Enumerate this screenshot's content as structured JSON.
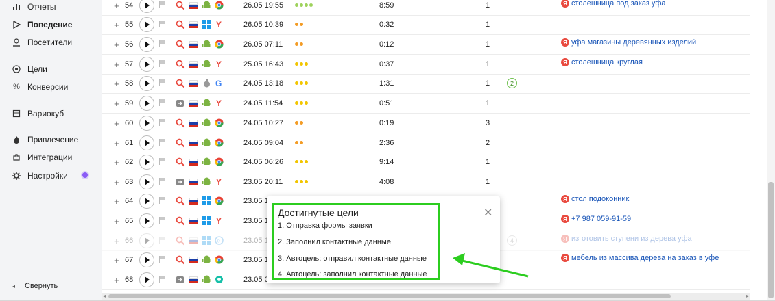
{
  "sidebar": {
    "items": [
      {
        "label": "Отчеты",
        "icon": "bar-chart-icon",
        "active": false
      },
      {
        "label": "Поведение",
        "icon": "play-outline-icon",
        "active": true
      },
      {
        "label": "Посетители",
        "icon": "user-icon",
        "active": false
      },
      {
        "label": "Цели",
        "icon": "target-icon",
        "active": false
      },
      {
        "label": "Конверсии",
        "icon": "percent-icon",
        "active": false
      },
      {
        "label": "Вариокуб",
        "icon": "cube-icon",
        "active": false
      },
      {
        "label": "Привлечение",
        "icon": "flame-icon",
        "active": false
      },
      {
        "label": "Интеграции",
        "icon": "puzzle-icon",
        "active": false
      },
      {
        "label": "Настройки",
        "icon": "gear-icon",
        "active": false
      }
    ],
    "collapse_label": "Свернуть"
  },
  "rows": [
    {
      "num": "54",
      "date": "26.05 19:55",
      "depth_dots": 4,
      "depth_color": "#9ed25c",
      "time": "8:59",
      "views": "1",
      "goals": "",
      "search": "столешница под заказ уфа",
      "os": "android",
      "browser": "chrome",
      "source": "search",
      "faded": false
    },
    {
      "num": "55",
      "date": "26.05 10:39",
      "depth_dots": 2,
      "depth_color": "#f39c25",
      "time": "0:32",
      "views": "1",
      "goals": "",
      "search": "",
      "os": "windows",
      "browser": "yandex",
      "source": "search",
      "faded": false
    },
    {
      "num": "56",
      "date": "26.05 07:11",
      "depth_dots": 2,
      "depth_color": "#f39c25",
      "time": "0:12",
      "views": "1",
      "goals": "",
      "search": "уфа магазины деревянных изделий",
      "os": "android",
      "browser": "chrome",
      "source": "search",
      "faded": false
    },
    {
      "num": "57",
      "date": "25.05 16:43",
      "depth_dots": 3,
      "depth_color": "#f2c500",
      "time": "0:37",
      "views": "1",
      "goals": "",
      "search": "столешница круглая",
      "os": "android",
      "browser": "yandex",
      "source": "search",
      "faded": false
    },
    {
      "num": "58",
      "date": "24.05 13:18",
      "depth_dots": 3,
      "depth_color": "#f2c500",
      "time": "1:31",
      "views": "1",
      "goals": "2",
      "search": "",
      "os": "apple",
      "browser": "google",
      "source": "search",
      "faded": false
    },
    {
      "num": "59",
      "date": "24.05 11:54",
      "depth_dots": 3,
      "depth_color": "#f2c500",
      "time": "0:51",
      "views": "1",
      "goals": "",
      "search": "",
      "os": "android",
      "browser": "yandex",
      "source": "direct",
      "faded": false
    },
    {
      "num": "60",
      "date": "24.05 10:27",
      "depth_dots": 2,
      "depth_color": "#f39c25",
      "time": "0:19",
      "views": "3",
      "goals": "",
      "search": "",
      "os": "android",
      "browser": "chrome",
      "source": "search",
      "faded": false
    },
    {
      "num": "61",
      "date": "24.05 09:04",
      "depth_dots": 2,
      "depth_color": "#f39c25",
      "time": "2:36",
      "views": "2",
      "goals": "",
      "search": "",
      "os": "android",
      "browser": "chrome",
      "source": "search",
      "faded": false
    },
    {
      "num": "62",
      "date": "24.05 06:26",
      "depth_dots": 3,
      "depth_color": "#f2c500",
      "time": "9:14",
      "views": "1",
      "goals": "",
      "search": "",
      "os": "android",
      "browser": "chrome",
      "source": "search",
      "faded": false
    },
    {
      "num": "63",
      "date": "23.05 20:11",
      "depth_dots": 3,
      "depth_color": "#f2c500",
      "time": "4:08",
      "views": "1",
      "goals": "",
      "search": "",
      "os": "android",
      "browser": "yandex",
      "source": "direct",
      "faded": false
    },
    {
      "num": "64",
      "date": "23.05 1",
      "depth_dots": 0,
      "depth_color": "#f2c500",
      "time": "",
      "views": "",
      "goals": "",
      "search": "стол подоконник",
      "os": "windows",
      "browser": "chrome",
      "source": "search",
      "faded": false
    },
    {
      "num": "65",
      "date": "23.05 1",
      "depth_dots": 0,
      "depth_color": "#f2c500",
      "time": "",
      "views": "",
      "goals": "",
      "search": "+7 987 059-91-59",
      "os": "windows",
      "browser": "yandex",
      "source": "search",
      "faded": false
    },
    {
      "num": "66",
      "date": "23.05 1",
      "depth_dots": 0,
      "depth_color": "#f2c500",
      "time": "",
      "views": "",
      "goals": "4",
      "search": "изготовить ступени из дерева уфа",
      "os": "windows",
      "browser": "edge",
      "source": "search",
      "faded": true
    },
    {
      "num": "67",
      "date": "23.05 1",
      "depth_dots": 0,
      "depth_color": "#f2c500",
      "time": "",
      "views": "",
      "goals": "",
      "search": "мебель из массива дерева на заказ в уфе",
      "os": "android",
      "browser": "chrome",
      "source": "search",
      "faded": false
    },
    {
      "num": "68",
      "date": "23.05 0",
      "depth_dots": 0,
      "depth_color": "#f2c500",
      "time": "",
      "views": "",
      "goals": "",
      "search": "",
      "os": "android",
      "browser": "atom",
      "source": "direct",
      "faded": false
    }
  ],
  "popup": {
    "title": "Достигнутые цели",
    "goals": [
      "1. Отправка формы заявки",
      "2. Заполнил контактные данные",
      "3. Автоцель: отправил контактные данные",
      "4. Автоцель: заполнил контактные данные"
    ]
  },
  "colors": {
    "highlight": "#2ccd1f",
    "link": "#1a56b8",
    "yandex_red": "#e94a3f",
    "active_badge": "#8a5cf6"
  }
}
